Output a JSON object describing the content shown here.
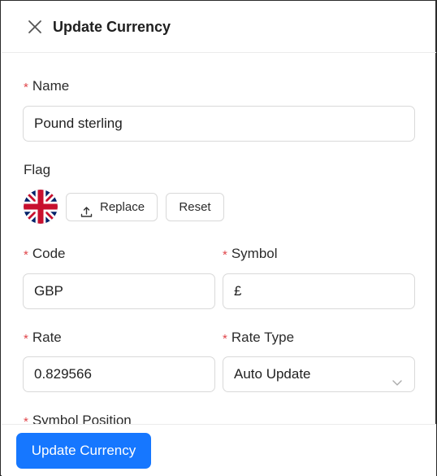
{
  "header": {
    "title": "Update Currency",
    "close_icon": "close-icon"
  },
  "form": {
    "name": {
      "label": "Name",
      "required": true,
      "value": "Pound sterling"
    },
    "flag": {
      "label": "Flag",
      "image": "uk-flag-icon",
      "replace_label": "Replace",
      "replace_icon": "upload-icon",
      "reset_label": "Reset"
    },
    "code": {
      "label": "Code",
      "required": true,
      "value": "GBP"
    },
    "symbol": {
      "label": "Symbol",
      "required": true,
      "value": "£"
    },
    "rate": {
      "label": "Rate",
      "required": true,
      "value": "0.829566"
    },
    "rate_type": {
      "label": "Rate Type",
      "required": true,
      "value": "Auto Update",
      "icon": "chevron-down-icon"
    },
    "symbol_position": {
      "label": "Symbol Position",
      "required": true
    }
  },
  "footer": {
    "submit_label": "Update Currency"
  },
  "colors": {
    "primary": "#1677ff",
    "required": "#e0454a",
    "border": "#d9d9d9"
  }
}
